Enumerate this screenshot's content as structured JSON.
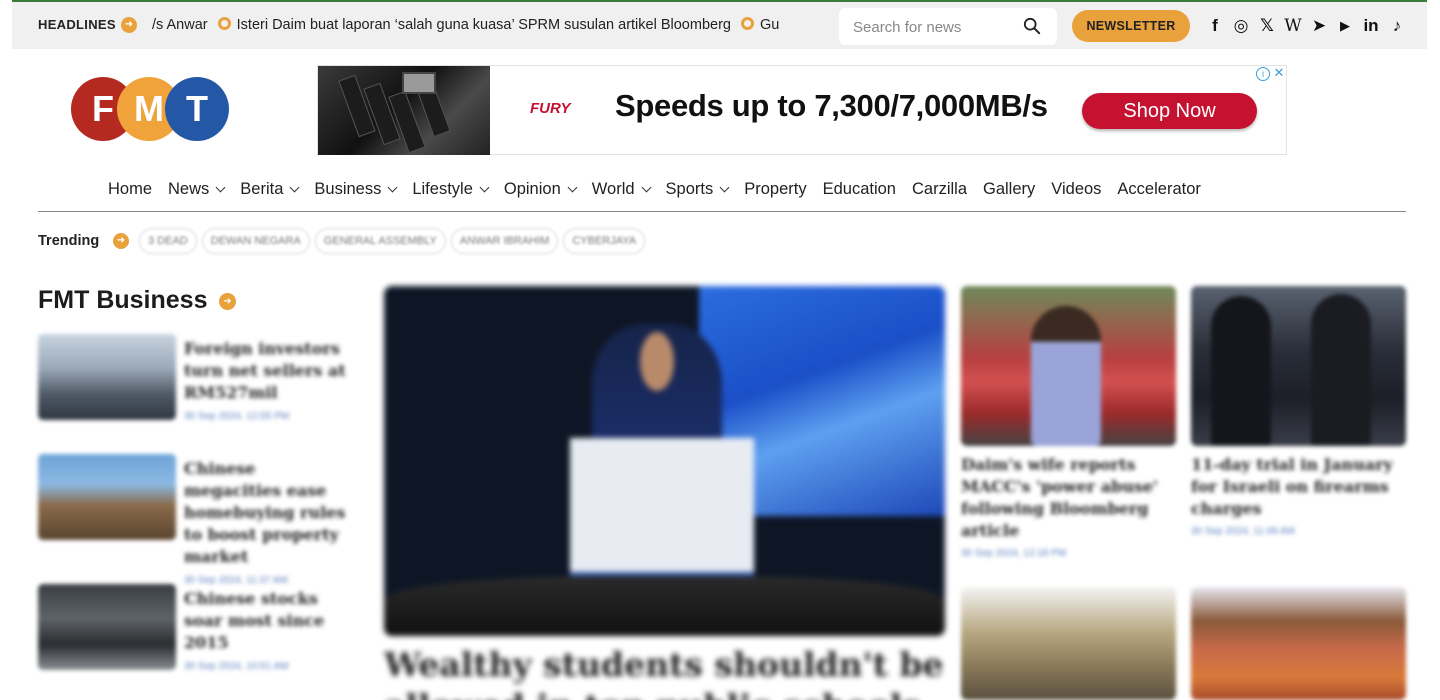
{
  "topbar": {
    "headlines_label": "HEADLINES",
    "ticker": [
      "/s Anwar",
      "Isteri Daim buat laporan ‘salah guna kuasa’ SPRM susulan artikel Bloomberg",
      "Gu"
    ],
    "search_placeholder": "Search for news",
    "newsletter_label": "NEWSLETTER",
    "socials": [
      {
        "name": "facebook-icon",
        "glyph": "f"
      },
      {
        "name": "instagram-icon",
        "glyph": "◎"
      },
      {
        "name": "x-icon",
        "glyph": "𝕏"
      },
      {
        "name": "wikipedia-icon",
        "glyph": "W"
      },
      {
        "name": "telegram-icon",
        "glyph": "➤"
      },
      {
        "name": "youtube-icon",
        "glyph": "▶"
      },
      {
        "name": "linkedin-icon",
        "glyph": "in"
      },
      {
        "name": "tiktok-icon",
        "glyph": "♪"
      }
    ]
  },
  "logo": {
    "f": "F",
    "m": "M",
    "t": "T"
  },
  "ad": {
    "brand": "FURY",
    "headline": "Speeds up to 7,300/7,000MB/s",
    "cta": "Shop Now",
    "info": "i",
    "close": "✕"
  },
  "nav": [
    {
      "label": "Home",
      "dropdown": false
    },
    {
      "label": "News",
      "dropdown": true
    },
    {
      "label": "Berita",
      "dropdown": true
    },
    {
      "label": "Business",
      "dropdown": true
    },
    {
      "label": "Lifestyle",
      "dropdown": true
    },
    {
      "label": "Opinion",
      "dropdown": true
    },
    {
      "label": "World",
      "dropdown": true
    },
    {
      "label": "Sports",
      "dropdown": true
    },
    {
      "label": "Property",
      "dropdown": false
    },
    {
      "label": "Education",
      "dropdown": false
    },
    {
      "label": "Carzilla",
      "dropdown": false
    },
    {
      "label": "Gallery",
      "dropdown": false
    },
    {
      "label": "Videos",
      "dropdown": false
    },
    {
      "label": "Accelerator",
      "dropdown": false
    }
  ],
  "trending": {
    "label": "Trending",
    "tags": [
      "3 DEAD",
      "DEWAN NEGARA",
      "GENERAL ASSEMBLY",
      "ANWAR IBRAHIM",
      "CYBERJAYA"
    ]
  },
  "business": {
    "title": "FMT Business",
    "items": [
      {
        "title": "Foreign investors turn net sellers at RM527mil",
        "date": "30 Sep 2024, 12:55 PM"
      },
      {
        "title": "Chinese megacities ease homebuying rules to boost property market",
        "date": "30 Sep 2024, 11:37 AM"
      },
      {
        "title": "Chinese stocks soar most since 2015",
        "date": "30 Sep 2024, 10:51 AM"
      }
    ]
  },
  "hero": {
    "title": "Wealthy students shouldn't be allowed in top public schools"
  },
  "cards": [
    {
      "title": "Daim's wife reports MACC's 'power abuse' following Bloomberg article",
      "date": "30 Sep 2024, 12:18 PM"
    },
    {
      "title": "11-day trial in January for Israeli on firearms charges",
      "date": "30 Sep 2024, 11:49 AM"
    }
  ],
  "colors": {
    "accent": "#e9a13b",
    "brand_red": "#b42a20",
    "brand_orange": "#f0a33a",
    "brand_blue": "#2458a6",
    "ad_red": "#c41230",
    "date_blue": "#5a7fc0"
  }
}
